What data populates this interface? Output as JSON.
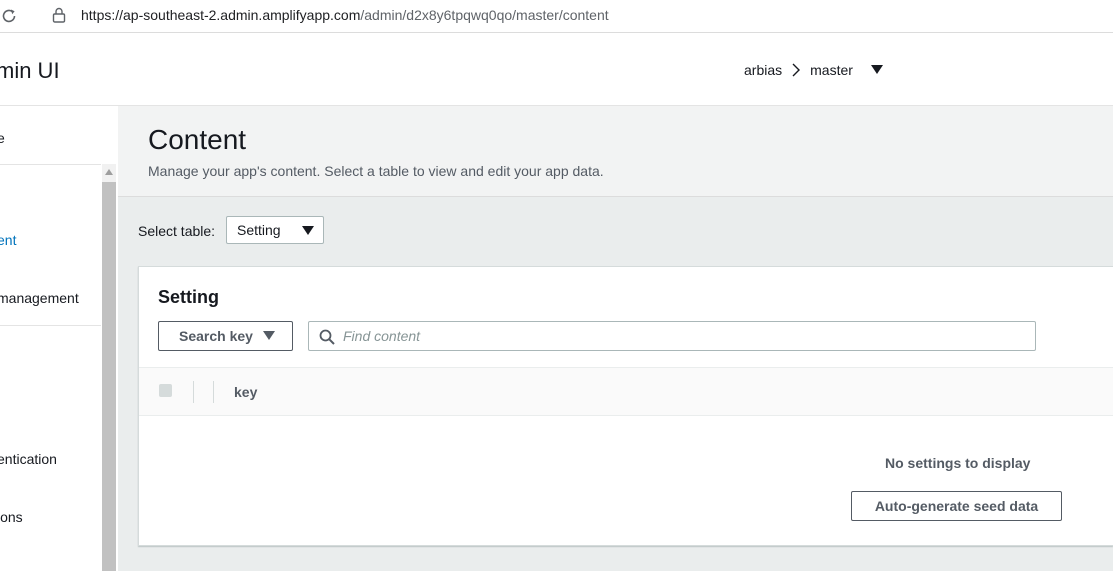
{
  "browser": {
    "url_host": "https://ap-southeast-2.admin.amplifyapp.com",
    "url_path": "/admin/d2x8y6tpqwq0qo/master/content"
  },
  "header": {
    "app_title": "min UI",
    "breadcrumb": {
      "app": "arbias",
      "environment": "master"
    }
  },
  "sidebar": {
    "items": [
      {
        "label": "e",
        "active": false
      },
      {
        "label": "ent",
        "active": true
      },
      {
        "label": "management",
        "active": false
      },
      {
        "label": "entication",
        "active": false
      },
      {
        "label": "ions",
        "active": false
      }
    ]
  },
  "main": {
    "title": "Content",
    "description": "Manage your app's content. Select a table to view and edit your app data.",
    "select_table": {
      "label": "Select table:",
      "value": "Setting"
    },
    "panel": {
      "title": "Setting",
      "search_key_label": "Search key",
      "find_placeholder": "Find content",
      "find_value": "",
      "columns": [
        "key"
      ],
      "empty_message": "No settings to display",
      "seed_button_label": "Auto-generate seed data"
    }
  },
  "colors": {
    "accent_link": "#0073bb",
    "text_primary": "#16191f",
    "text_secondary": "#545b64",
    "main_bg": "#f2f3f3"
  }
}
